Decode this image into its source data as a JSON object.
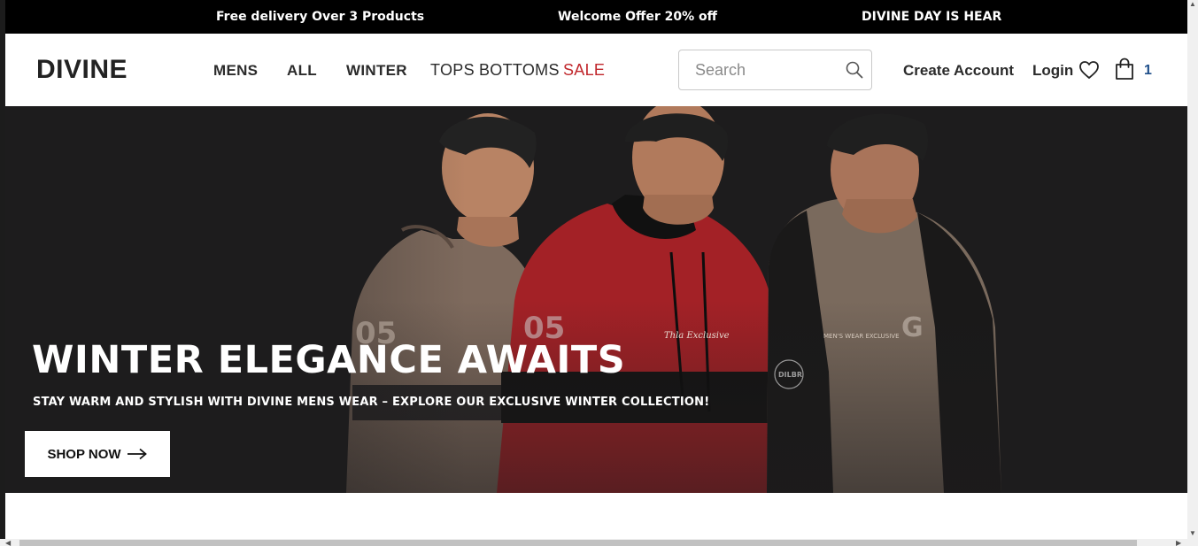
{
  "announcement": {
    "items": [
      "Free delivery Over 3 Products",
      "Welcome Offer 20% off",
      "DIVINE DAY IS HEAR"
    ]
  },
  "header": {
    "logo": "DIVINE",
    "nav": [
      "MENS",
      "ALL",
      "WINTER",
      "TOPS",
      "BOTTOMS",
      "SALE"
    ],
    "search": {
      "placeholder": "Search",
      "value": ""
    },
    "create_account": "Create Account",
    "login": "Login",
    "cart_count": "1"
  },
  "hero": {
    "title": "WINTER ELEGANCE AWAITS",
    "subtitle": "STAY WARM AND STYLISH WITH DIVINE MENS WEAR – EXPLORE OUR EXCLUSIVE WINTER COLLECTION!",
    "cta": "SHOP NOW",
    "hoodie_texts": [
      "05",
      "05",
      "Thla Exclusive",
      "MEN'S WEAR EXCLUSIVE",
      "DILBR"
    ]
  },
  "colors": {
    "sale": "#c0262b",
    "hero_bg": "#1d1c1d",
    "hoodie_tan": "#8a7566",
    "hoodie_red": "#a32126",
    "cart_count": "#1f4f8a"
  }
}
